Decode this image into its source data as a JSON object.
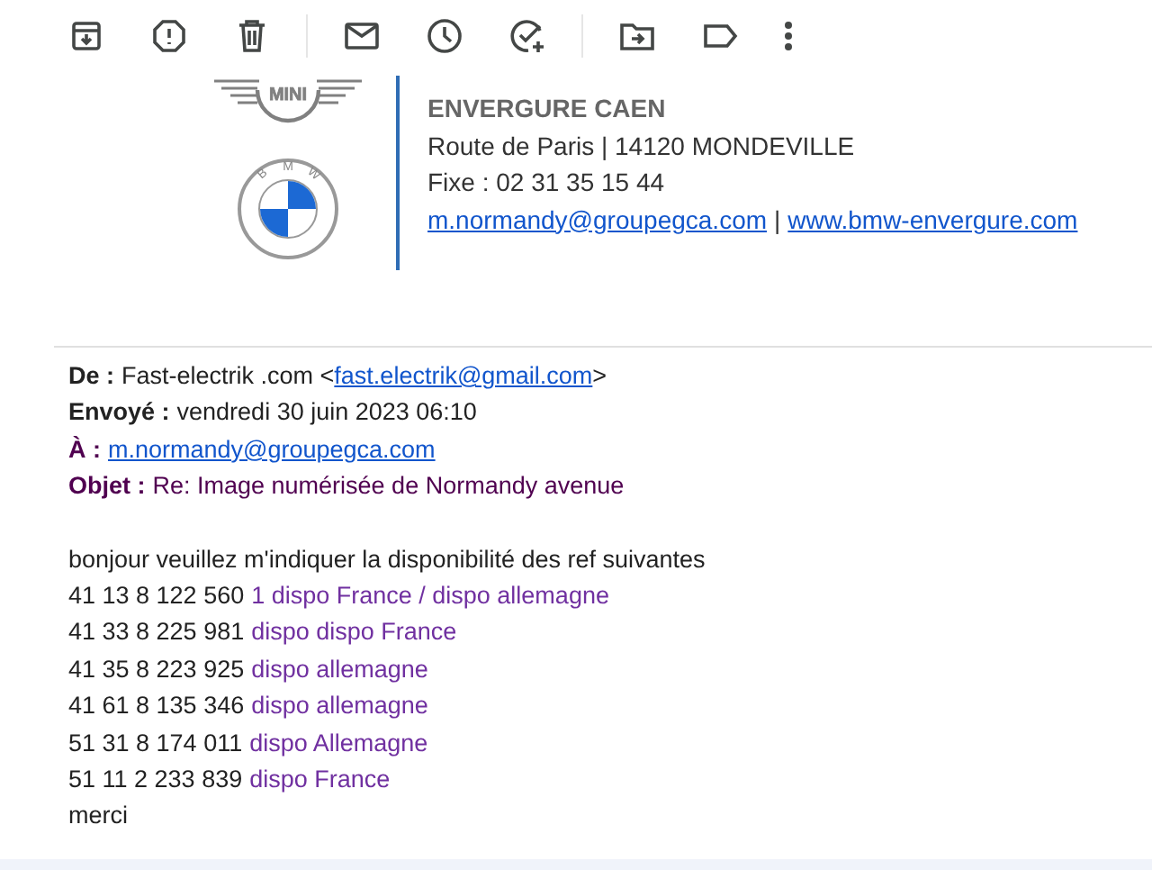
{
  "signature": {
    "logo_text": "MINI",
    "emblem_letters": [
      "B",
      "M",
      "W"
    ],
    "company": "ENVERGURE CAEN",
    "address": "Route de Paris | 14120 MONDEVILLE",
    "phone": "Fixe : 02 31 35 15 44",
    "email": "m.normandy@groupegca.com",
    "separator": "|",
    "website": "www.bmw-envergure.com"
  },
  "header": [
    {
      "label": "De :",
      "text": "Fast-electrik .com <",
      "link": "fast.electrik@gmail.com",
      "after": ">",
      "color": "#222222"
    },
    {
      "label": "Envoyé :",
      "text": "vendredi 30 juin 2023 06:10",
      "color": "#222222"
    },
    {
      "label": "À :",
      "link": "m.normandy@groupegca.com",
      "color": "#500050"
    },
    {
      "label": "Objet :",
      "text": "Re: Image numérisée de Normandy avenue",
      "color": "#500050"
    }
  ],
  "body": {
    "greeting": "bonjour veuillez m'indiquer la disponibilité des ref suivantes",
    "refs": [
      {
        "ref": "41 13 8 122 560",
        "status": "1 dispo France / dispo allemagne"
      },
      {
        "ref": "41 33 8 225 981",
        "status": "dispo dispo France"
      },
      {
        "ref": "41 35 8 223 925",
        "status": "dispo allemagne"
      },
      {
        "ref": "41 61 8 135 346",
        "status": "dispo allemagne"
      },
      {
        "ref": "51 31 8 174 011",
        "status": "dispo Allemagne"
      },
      {
        "ref": "51 11 2 233 839",
        "status": "dispo France"
      }
    ],
    "closing": "merci"
  }
}
